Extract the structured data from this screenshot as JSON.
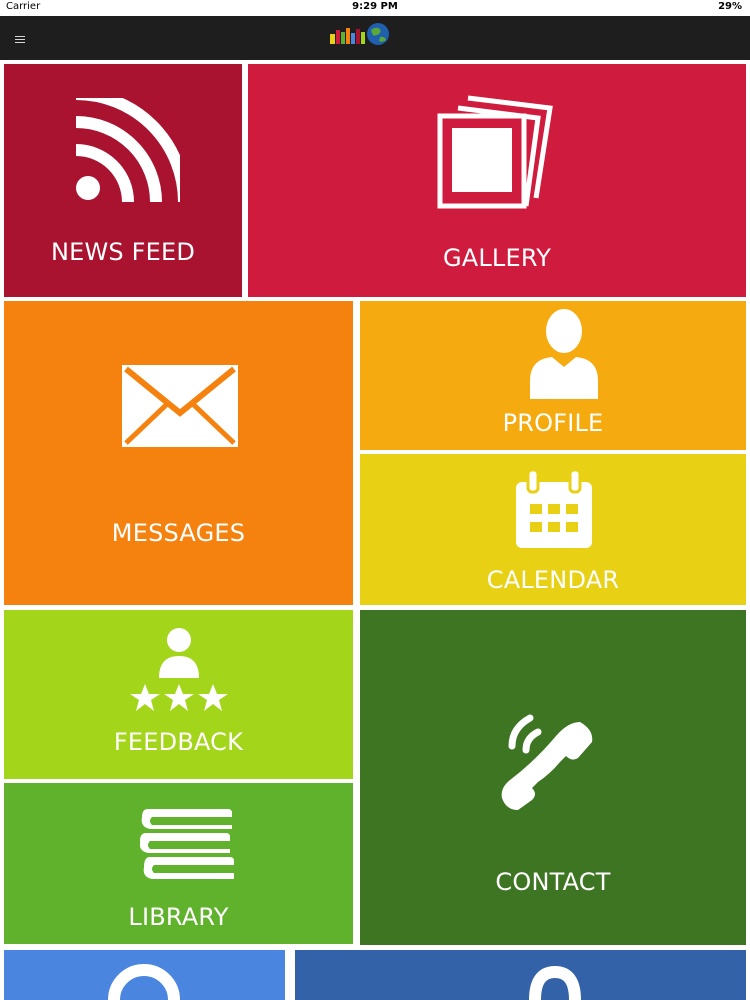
{
  "status_bar": {
    "carrier": "Carrier",
    "time": "9:29 PM",
    "battery": "29%"
  },
  "nav": {
    "menu_icon": "hamburger-icon",
    "logo_icon": "school-logo-globe"
  },
  "tiles": {
    "news_feed": {
      "label": "NEWS FEED",
      "icon": "rss-icon",
      "color": "#a91330"
    },
    "gallery": {
      "label": "GALLERY",
      "icon": "photo-stack-icon",
      "color": "#cf1b3d"
    },
    "messages": {
      "label": "MESSAGES",
      "icon": "envelope-icon",
      "color": "#f5810f"
    },
    "profile": {
      "label": "PROFILE",
      "icon": "user-icon",
      "color": "#f5ab0f"
    },
    "calendar": {
      "label": "CALENDAR",
      "icon": "calendar-icon",
      "color": "#e8d115"
    },
    "feedback": {
      "label": "FEEDBACK",
      "icon": "rating-stars-icon",
      "color": "#a3d51a"
    },
    "library": {
      "label": "LIBRARY",
      "icon": "books-icon",
      "color": "#60b22d"
    },
    "contact": {
      "label": "CONTACT",
      "icon": "phone-icon",
      "color": "#3e7523"
    },
    "bottom_left": {
      "color": "#4a86e0",
      "icon": "partial-icon"
    },
    "bottom_right": {
      "color": "#3362a8",
      "icon": "partial-icon"
    }
  }
}
